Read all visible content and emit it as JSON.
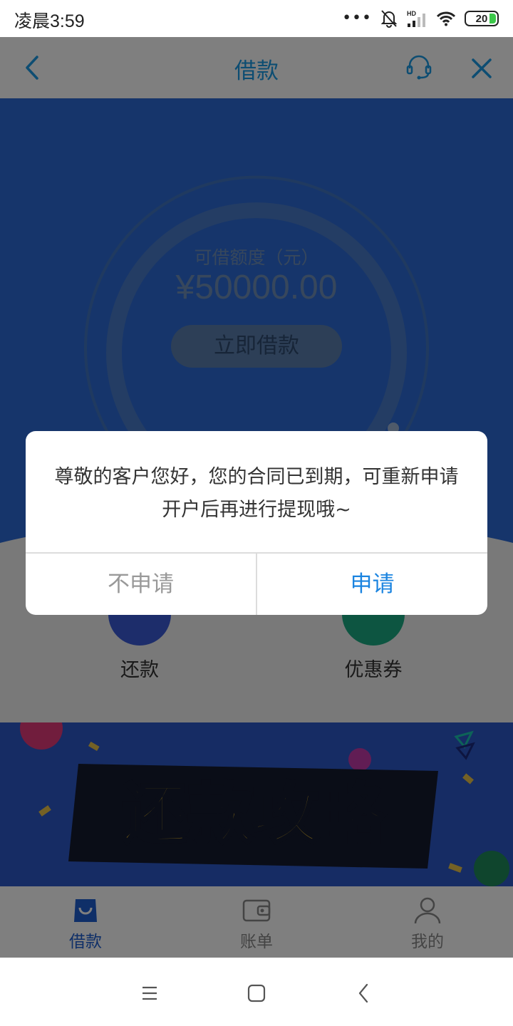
{
  "status_bar": {
    "time": "凌晨3:59",
    "battery": "20",
    "network": "HD"
  },
  "header": {
    "title": "借款",
    "accent_color": "#1b9ae5"
  },
  "credit": {
    "label": "可借额度（元）",
    "amount": "¥50000.00",
    "button": "立即借款"
  },
  "quick_actions": [
    {
      "label": "还款",
      "icon": "repay-icon"
    },
    {
      "label": "优惠券",
      "icon": "coupon-icon"
    }
  ],
  "banner": {
    "text": "还款攻略"
  },
  "tabs": [
    {
      "label": "借款",
      "icon": "loan-bag-icon",
      "active": true
    },
    {
      "label": "账单",
      "icon": "wallet-icon",
      "active": false
    },
    {
      "label": "我的",
      "icon": "person-icon",
      "active": false
    }
  ],
  "dialog": {
    "message": "尊敬的客户您好，您的合同已到期，可重新申请开户后再进行提现哦~",
    "cancel_label": "不申请",
    "confirm_label": "申请",
    "confirm_color": "#1b84e0"
  }
}
